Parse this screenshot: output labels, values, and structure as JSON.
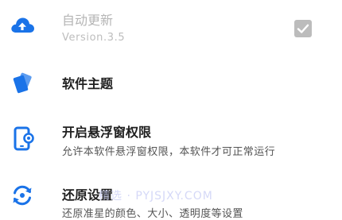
{
  "settings": {
    "auto_update": {
      "title": "自动更新",
      "version": "Version.3.5",
      "checked": true,
      "icon": "cloud-upload-icon"
    },
    "theme": {
      "title": "软件主题",
      "icon": "theme-cards-icon"
    },
    "float_permission": {
      "title": "开启悬浮窗权限",
      "description": "允许本软件悬浮窗权限，本软件才可正常运行",
      "icon": "phone-overlay-icon"
    },
    "reset": {
      "title": "还原设置",
      "description": "还原准星的颜色、大小、透明度等设置",
      "icon": "reset-icon"
    }
  },
  "watermark": "精选 · PYJSJXY.COM",
  "colors": {
    "accent": "#1a73e8",
    "checkbox": "#bcbcbc"
  }
}
